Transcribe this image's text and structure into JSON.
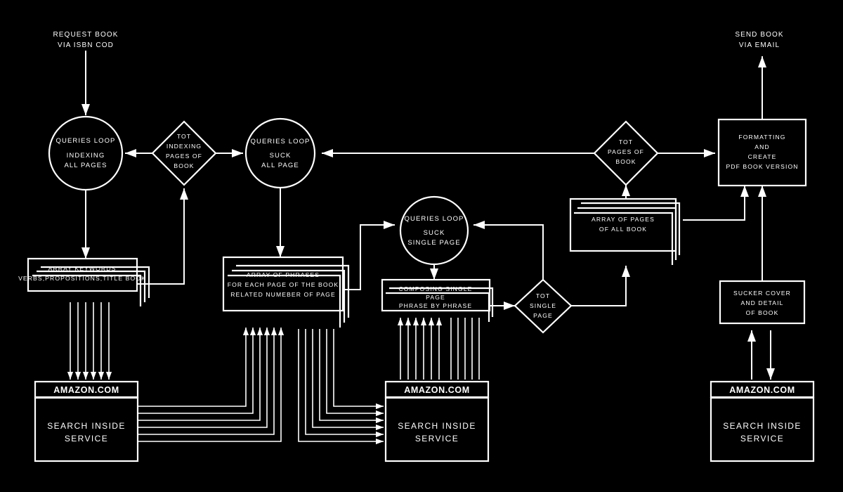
{
  "diagram": {
    "title": "Amazon Search Inside book scraping flowchart",
    "background_color": "#000000",
    "stroke_color": "#ffffff"
  },
  "free_labels": [
    {
      "id": "request",
      "lines": [
        "REQUEST BOOK",
        "VIA ISBN COD"
      ]
    },
    {
      "id": "send",
      "lines": [
        "SEND BOOK",
        "VIA EMAIL"
      ]
    }
  ],
  "nodes": {
    "circle_indexing": {
      "lines": [
        "QUERIES LOOP",
        "INDEXING",
        "ALL PAGES"
      ]
    },
    "diamond_tot_indexing": {
      "lines": [
        "TOT",
        "INDEXING",
        "PAGES OF",
        "BOOK"
      ]
    },
    "circle_suck_all": {
      "lines": [
        "QUERIES LOOP",
        "SUCK",
        "ALL PAGE"
      ]
    },
    "circle_suck_single": {
      "lines": [
        "QUERIES LOOP",
        "SUCK",
        "SINGLE PAGE"
      ]
    },
    "diamond_tot_pages": {
      "lines": [
        "TOT",
        "PAGES OF",
        "BOOK"
      ]
    },
    "diamond_tot_single": {
      "lines": [
        "TOT",
        "SINGLE",
        "PAGE"
      ]
    },
    "box_formatting": {
      "lines": [
        "FORMATTING",
        "AND",
        "CREATE",
        "PDF BOOK VERSION"
      ]
    },
    "stack_keywords": {
      "lines": [
        "ARRAY KEYWORDS",
        "VERBS,PROPOSITIONS,TITLE BOOK"
      ]
    },
    "stack_phrases": {
      "lines": [
        "ARRAY OF PHRASES",
        "FOR EACH PAGE OF THE BOOK",
        "RELATED NUMEBER OF PAGE"
      ]
    },
    "stack_composing": {
      "lines": [
        "COMPOSING SINGLE",
        "PAGE",
        "PHRASE BY PHRASE"
      ]
    },
    "stack_pages": {
      "lines": [
        "ARRAY OF PAGES",
        "OF ALL BOOK"
      ]
    },
    "box_sucker_cover": {
      "lines": [
        "SUCKER COVER",
        "AND DETAIL",
        "OF BOOK"
      ]
    },
    "amazon_left": {
      "header": "AMAZON.COM",
      "lines": [
        "SEARCH INSIDE",
        "SERVICE"
      ]
    },
    "amazon_center": {
      "header": "AMAZON.COM",
      "lines": [
        "SEARCH INSIDE",
        "SERVICE"
      ]
    },
    "amazon_right": {
      "header": "AMAZON.COM",
      "lines": [
        "SEARCH INSIDE",
        "SERVICE"
      ]
    }
  }
}
